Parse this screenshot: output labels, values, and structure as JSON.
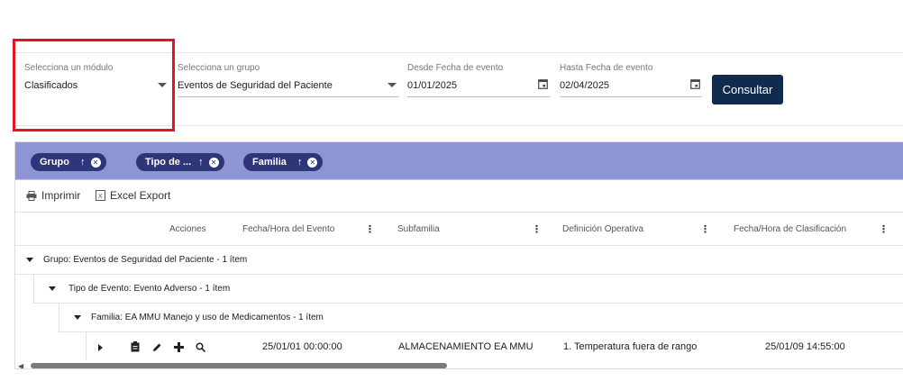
{
  "filters": {
    "module": {
      "label": "Selecciona un módulo",
      "value": "Clasificados"
    },
    "group": {
      "label": "Selecciona un grupo",
      "value": "Eventos de Seguridad del Paciente"
    },
    "from_date": {
      "label": "Desde Fecha de evento",
      "value": "01/01/2025"
    },
    "to_date": {
      "label": "Hasta Fecha de evento",
      "value": "02/04/2025"
    },
    "consultar_label": "Consultar"
  },
  "group_chips": [
    {
      "label": "Grupo"
    },
    {
      "label": "Tipo de ..."
    },
    {
      "label": "Familia"
    }
  ],
  "toolbar": {
    "print_label": "Imprimir",
    "excel_label": "Excel Export"
  },
  "columns": {
    "acciones": "Acciones",
    "fecha_evento": "Fecha/Hora del Evento",
    "subfamilia": "Subfamilia",
    "definicion": "Definición Operativa",
    "fecha_clasificacion": "Fecha/Hora de Clasificación"
  },
  "groups": {
    "level1": "Grupo: Eventos de Seguridad del Paciente - 1 ítem",
    "level2": "Tipo de Evento: Evento Adverso - 1 ítem",
    "level3": "Familia: EA MMU Manejo y uso de Medicamentos - 1 ítem"
  },
  "row": {
    "fecha_evento": "25/01/01 00:00:00",
    "subfamilia": "ALMACENAMIENTO EA MMU",
    "definicion": "1. Temperatura fuera de rango",
    "fecha_clasificacion": "25/01/09 14:55:00"
  },
  "colors": {
    "primary": "#0f2c4e",
    "group_panel": "#8e95d5",
    "chip": "#2e3578",
    "highlight": "#e3141b"
  }
}
